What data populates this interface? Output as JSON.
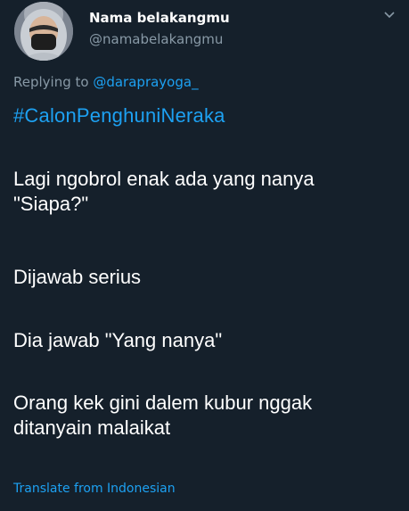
{
  "author": {
    "display_name": "Nama belakangmu",
    "handle": "@namabelakangmu"
  },
  "reply": {
    "prefix": "Replying to ",
    "mention": "@daraprayoga_"
  },
  "tweet": {
    "hashtag": "#CalonPenghuniNeraka",
    "lines": [
      "Lagi ngobrol enak ada yang nanya",
      "\"Siapa?\"",
      "Dijawab serius",
      "Dia jawab \"Yang nanya\"",
      "Orang kek gini dalem kubur nggak",
      "ditanyain malaikat"
    ]
  },
  "translate_label": "Translate from Indonesian",
  "colors": {
    "background": "#15202b",
    "accent": "#1da1f2",
    "secondary_text": "#8899a6",
    "primary_text": "#ffffff"
  },
  "icons": {
    "menu": "chevron-down-icon"
  }
}
